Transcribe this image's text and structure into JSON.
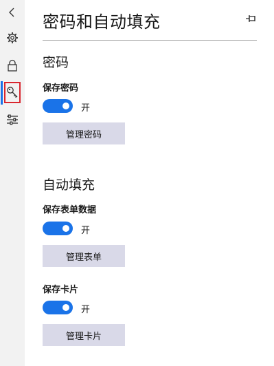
{
  "header": {
    "title": "密码和自动填充"
  },
  "nav": {
    "items": [
      {
        "icon": "back-arrow-icon"
      },
      {
        "icon": "gear-icon"
      },
      {
        "icon": "lock-icon"
      },
      {
        "icon": "key-icon",
        "selected": true
      },
      {
        "icon": "sliders-icon"
      }
    ],
    "accent_color": "#1a73e8",
    "highlight_color": "#d9262f"
  },
  "passwords": {
    "heading": "密码",
    "save_label": "保存密码",
    "save_state": "开",
    "save_enabled": true,
    "manage_button": "管理密码"
  },
  "autofill": {
    "heading": "自动填充",
    "form_label": "保存表单数据",
    "form_state": "开",
    "form_enabled": true,
    "manage_forms_button": "管理表单",
    "card_label": "保存卡片",
    "card_state": "开",
    "card_enabled": true,
    "manage_cards_button": "管理卡片"
  },
  "colors": {
    "toggle_on": "#1a73e8",
    "button_bg": "#d9d9e8",
    "rail_bg": "#f2f2f2"
  }
}
